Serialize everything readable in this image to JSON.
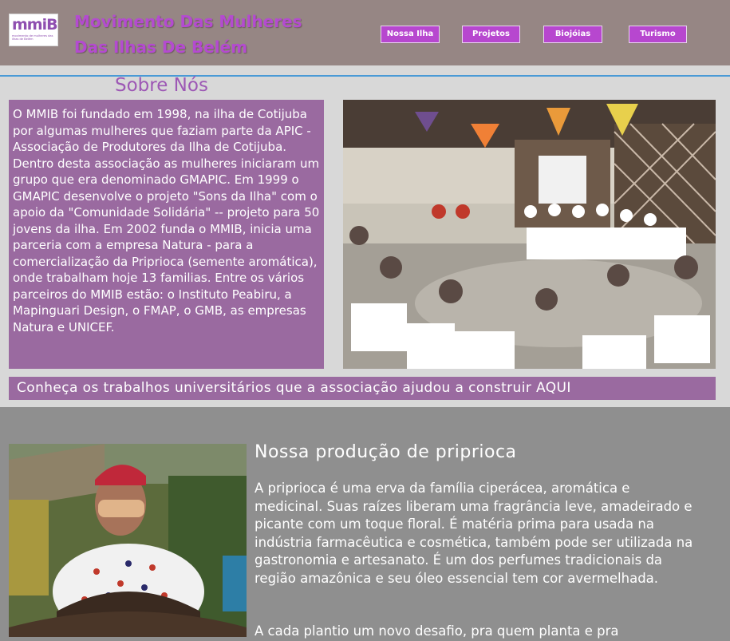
{
  "header": {
    "logo_text": "mmiB",
    "logo_tagline": "movimento de mulheres das ilhas de Belém",
    "title_line1": "Movimento Das Mulheres",
    "title_line2": "Das Ilhas De Belém",
    "nav": [
      {
        "label": "Nossa Ilha"
      },
      {
        "label": "Projetos"
      },
      {
        "label": "Biojóias"
      },
      {
        "label": "Turismo"
      }
    ]
  },
  "about": {
    "title": "Sobre Nós",
    "text": "O MMIB foi fundado em 1998, na ilha de Cotijuba por algumas mulheres que faziam parte da APIC - Associação de Produtores da Ilha de Cotijuba. Dentro desta associação as mulheres iniciaram um grupo que era denominado GMAPIC. Em 1999 o GMAPIC desenvolve o projeto \"Sons da Ilha\" com o apoio da \"Comunidade Solidária\" -- projeto para 50 jovens da ilha. Em 2002 funda o MMIB, inicia uma parceria com a empresa Natura - para a comercialização da Priprioca (semente aromática), onde trabalham hoje 13 familias. Entre os vários parceiros do MMIB estão: o Instituto Peabiru, a Mapinguari Design, o FMAP, o GMB, as empresas Natura e UNICEF.",
    "banner_link": "Conheça os trabalhos universitários que a associação ajudou a construir AQUI"
  },
  "production": {
    "title": "Nossa produção de priprioca",
    "text": "A priprioca é uma erva da família ciperácea, aromática e medicinal. Suas raízes liberam uma fragrância leve, amadeirado e picante com um toque floral. É matéria prima para usada na indústria farmacêutica e cosmética, também pode ser utilizada na gastronomia e artesanato. É um dos perfumes tradicionais da região amazônica e seu óleo essencial tem cor avermelhada.",
    "text2": " A cada plantio um novo desafio, pra quem planta e pra"
  },
  "colors": {
    "header_bg": "#968684",
    "accent_purple": "#b747cf",
    "box_purple": "#9a6aa0",
    "link_blue": "#4a9ad6"
  }
}
